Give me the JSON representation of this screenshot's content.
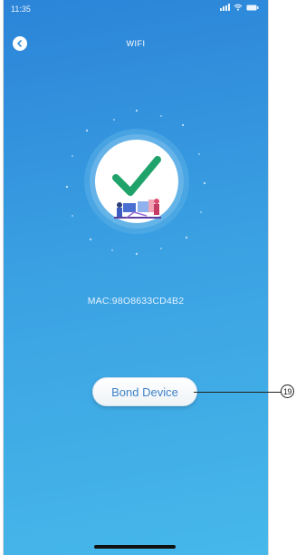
{
  "status_bar": {
    "time": "11:35"
  },
  "nav": {
    "title": "WIFI",
    "back_icon": "chevron-left-icon"
  },
  "hero": {
    "icon": "checkmark-icon",
    "illustration": "people-with-devices-illustration"
  },
  "device": {
    "mac_text": "MAC:98O8633CD4B2"
  },
  "actions": {
    "bond_label": "Bond Device"
  },
  "annotation": {
    "callout_number": "19"
  },
  "colors": {
    "background_top": "#2b84d8",
    "background_bottom": "#46b8ea",
    "check_green": "#1fa36a",
    "button_text": "#3f82c9"
  }
}
